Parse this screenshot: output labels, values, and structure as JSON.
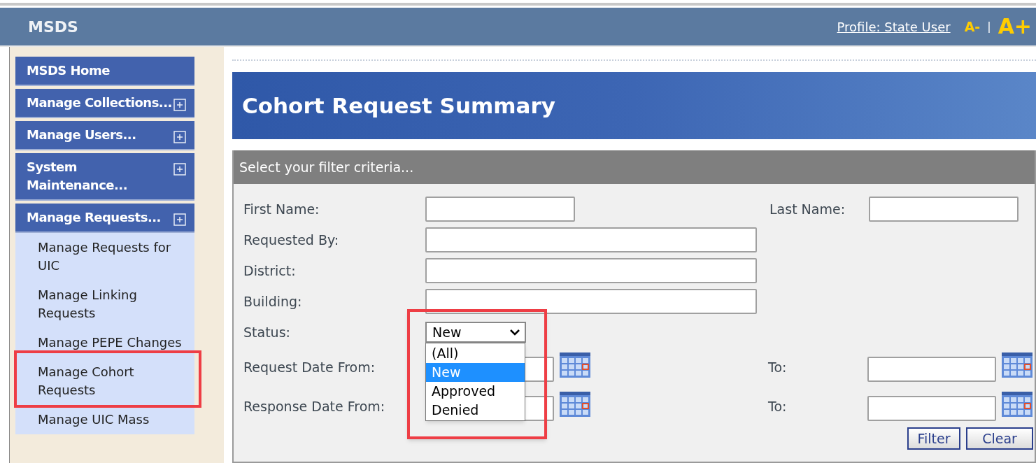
{
  "header": {
    "title": "MSDS",
    "profile_link": "Profile: State User",
    "font_smaller": "A-",
    "separator": "|",
    "font_larger": "A+"
  },
  "sidebar": {
    "items": [
      {
        "label": "MSDS Home",
        "expandable": false
      },
      {
        "label": "Manage Collections...",
        "expandable": true
      },
      {
        "label": "Manage Users...",
        "expandable": true
      },
      {
        "label": "System Maintenance...",
        "expandable": true
      },
      {
        "label": "Manage Requests...",
        "expandable": true,
        "children": [
          {
            "label": "Manage Requests for UIC",
            "highlighted": false
          },
          {
            "label": "Manage Linking Requests",
            "highlighted": false
          },
          {
            "label": "Manage PEPE Changes",
            "highlighted": false
          },
          {
            "label": "Manage Cohort Requests",
            "highlighted": true
          },
          {
            "label": "Manage UIC Mass",
            "highlighted": false
          }
        ]
      }
    ]
  },
  "page_title": "Cohort Request Summary",
  "filter": {
    "heading": "Select your filter criteria...",
    "rows": [
      {
        "kind": "short-text",
        "label": "First Name:",
        "right_label": "Last Name:"
      },
      {
        "kind": "text",
        "label": "Requested By:"
      },
      {
        "kind": "text",
        "label": "District:"
      },
      {
        "kind": "text",
        "label": "Building:"
      },
      {
        "kind": "select",
        "label": "Status:",
        "value": "New",
        "expanded": true,
        "highlighted": true,
        "options": [
          {
            "label": "(All)",
            "selected": false
          },
          {
            "label": "New",
            "selected": true
          },
          {
            "label": "Approved",
            "selected": false
          },
          {
            "label": "Denied",
            "selected": false
          }
        ]
      },
      {
        "kind": "date",
        "label": "Request Date From:",
        "right_label": "To:"
      },
      {
        "kind": "date",
        "label": "Response Date From:",
        "right_label": "To:"
      }
    ],
    "buttons": [
      "Filter",
      "Clear"
    ]
  }
}
